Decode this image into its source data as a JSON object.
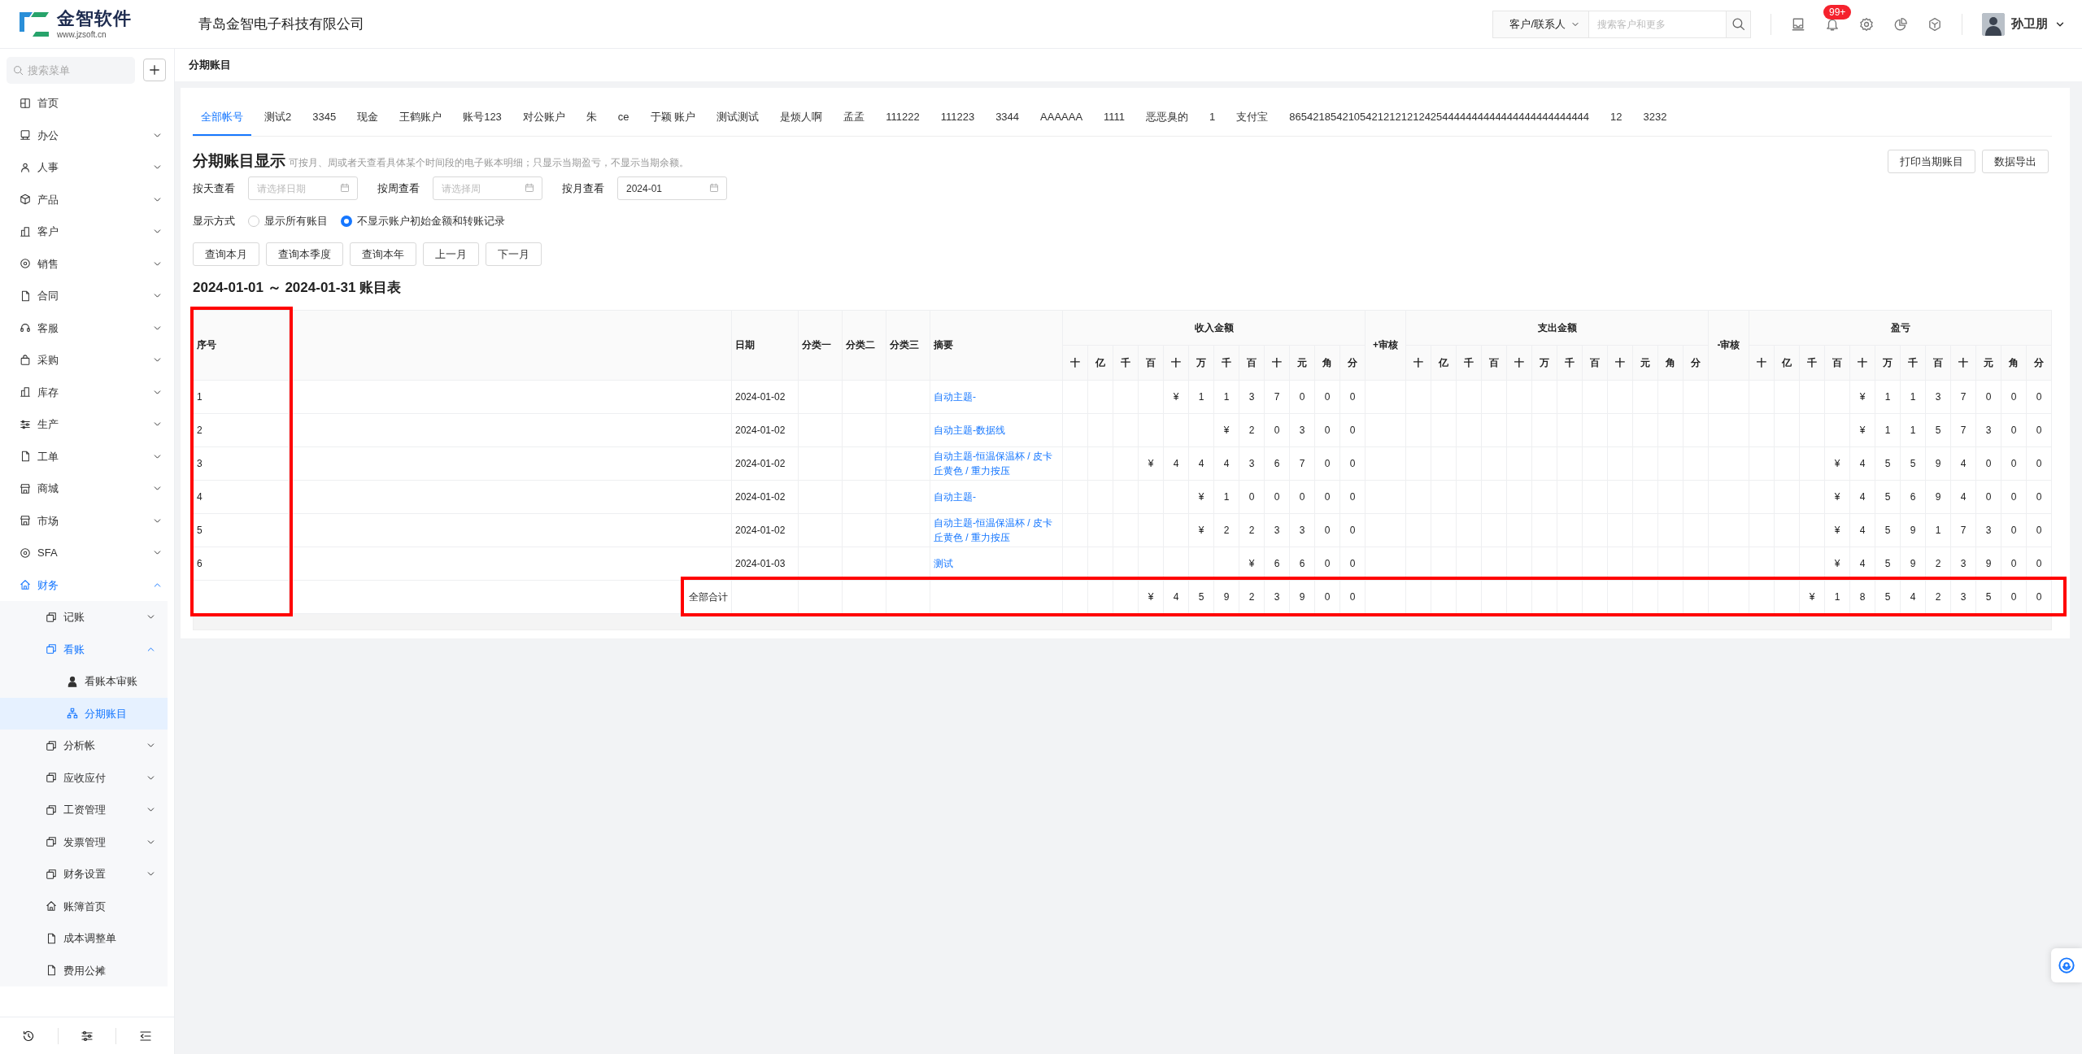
{
  "brand": {
    "name": "金智软件",
    "url": "www.jzsoft.cn"
  },
  "company": "青岛金智电子科技有限公司",
  "header": {
    "search_scope": "客户/联系人",
    "search_placeholder": "搜索客户和更多",
    "notification_badge": "99+",
    "user": "孙卫朋"
  },
  "sidebar": {
    "search_placeholder": "搜索菜单",
    "items": [
      {
        "label": "首页",
        "expandable": false,
        "selected": false
      },
      {
        "label": "办公",
        "expandable": true,
        "expanded": false,
        "selected": false
      },
      {
        "label": "人事",
        "expandable": true,
        "expanded": false,
        "selected": false
      },
      {
        "label": "产品",
        "expandable": true,
        "expanded": false,
        "selected": false
      },
      {
        "label": "客户",
        "expandable": true,
        "expanded": false,
        "selected": false
      },
      {
        "label": "销售",
        "expandable": true,
        "expanded": false,
        "selected": false
      },
      {
        "label": "合同",
        "expandable": true,
        "expanded": false,
        "selected": false
      },
      {
        "label": "客服",
        "expandable": true,
        "expanded": false,
        "selected": false
      },
      {
        "label": "采购",
        "expandable": true,
        "expanded": false,
        "selected": false
      },
      {
        "label": "库存",
        "expandable": true,
        "expanded": false,
        "selected": false
      },
      {
        "label": "生产",
        "expandable": true,
        "expanded": false,
        "selected": false
      },
      {
        "label": "工单",
        "expandable": true,
        "expanded": false,
        "selected": false
      },
      {
        "label": "商城",
        "expandable": true,
        "expanded": false,
        "selected": false
      },
      {
        "label": "市场",
        "expandable": true,
        "expanded": false,
        "selected": false
      },
      {
        "label": "SFA",
        "expandable": true,
        "expanded": false,
        "selected": false
      },
      {
        "label": "财务",
        "expandable": true,
        "expanded": true,
        "selected": false,
        "children": [
          {
            "label": "记账",
            "expandable": true,
            "expanded": false,
            "selected": false
          },
          {
            "label": "看账",
            "expandable": true,
            "expanded": true,
            "selected": false,
            "children": [
              {
                "label": "看账本审账",
                "expandable": false,
                "selected": false
              },
              {
                "label": "分期账目",
                "expandable": false,
                "selected": true
              }
            ]
          },
          {
            "label": "分析帐",
            "expandable": true,
            "expanded": false,
            "selected": false
          },
          {
            "label": "应收应付",
            "expandable": true,
            "expanded": false,
            "selected": false
          },
          {
            "label": "工资管理",
            "expandable": true,
            "expanded": false,
            "selected": false
          },
          {
            "label": "发票管理",
            "expandable": true,
            "expanded": false,
            "selected": false
          },
          {
            "label": "财务设置",
            "expandable": true,
            "expanded": false,
            "selected": false
          },
          {
            "label": "账簿首页",
            "expandable": false,
            "selected": false
          },
          {
            "label": "成本调整单",
            "expandable": false,
            "selected": false
          },
          {
            "label": "费用公摊",
            "expandable": false,
            "selected": false
          }
        ]
      }
    ]
  },
  "page_title": "分期账目",
  "tabs": [
    {
      "label": "全部帐号",
      "selected": true
    },
    {
      "label": "测试2",
      "selected": false
    },
    {
      "label": "3345",
      "selected": false
    },
    {
      "label": "现金",
      "selected": false
    },
    {
      "label": "王鹤账户",
      "selected": false
    },
    {
      "label": "账号123",
      "selected": false
    },
    {
      "label": "对公账户",
      "selected": false
    },
    {
      "label": "朱",
      "selected": false
    },
    {
      "label": "ce",
      "selected": false
    },
    {
      "label": "于颖 账户",
      "selected": false
    },
    {
      "label": "测试测试",
      "selected": false
    },
    {
      "label": "是烦人啊",
      "selected": false
    },
    {
      "label": "孟孟",
      "selected": false
    },
    {
      "label": "111222",
      "selected": false
    },
    {
      "label": "111223",
      "selected": false
    },
    {
      "label": "3344",
      "selected": false
    },
    {
      "label": "AAAAAA",
      "selected": false
    },
    {
      "label": "1111",
      "selected": false
    },
    {
      "label": "恶恶臭的",
      "selected": false
    },
    {
      "label": "1",
      "selected": false
    },
    {
      "label": "支付宝",
      "selected": false
    },
    {
      "label": "865421854210542121212124254444444444444444444444444",
      "selected": false
    },
    {
      "label": "12",
      "selected": false
    },
    {
      "label": "3232",
      "selected": false
    }
  ],
  "report": {
    "title": "分期账目显示",
    "hint": "可按月、周或者天查看具体某个时间段的电子账本明细；只显示当期盈亏，不显示当期余额。",
    "actions": [
      "打印当期账目",
      "数据导出"
    ]
  },
  "filters": [
    {
      "label": "按天查看",
      "placeholder": "请选择日期"
    },
    {
      "label": "按周查看",
      "placeholder": "请选择周"
    },
    {
      "label": "按月查看",
      "value": "2024-01"
    }
  ],
  "display_mode": {
    "label": "显示方式",
    "options": [
      {
        "label": "显示所有账目",
        "selected": false
      },
      {
        "label": "不显示账户初始金额和转账记录",
        "selected": true
      }
    ]
  },
  "quick_buttons": [
    "查询本月",
    "查询本季度",
    "查询本年",
    "上一月",
    "下一月"
  ],
  "table_title": "2024-01-01 ～ 2024-01-31 账目表",
  "table": {
    "headers": {
      "seq": "序号",
      "date": "日期",
      "category_1": "分类一",
      "category_2": "分类二",
      "category_3": "分类三",
      "summary": "摘要",
      "income_audit": "+审核",
      "expense_audit": "-审核"
    },
    "money_groups": [
      {
        "label": "收入金额",
        "units": [
          "十",
          "亿",
          "千",
          "百",
          "十",
          "万",
          "千",
          "百",
          "十",
          "元",
          "角",
          "分"
        ]
      },
      {
        "label": "支出金额",
        "units": [
          "十",
          "亿",
          "千",
          "百",
          "十",
          "万",
          "千",
          "百",
          "十",
          "元",
          "角",
          "分"
        ]
      },
      {
        "label": "盈亏",
        "units": [
          "十",
          "亿",
          "千",
          "百",
          "十",
          "万",
          "千",
          "百",
          "十",
          "元",
          "角",
          "分"
        ]
      }
    ],
    "seq_highlighted": true,
    "rows": [
      {
        "seq": "1",
        "date": "2024-01-02",
        "summary": "自动主题-",
        "income": [
          "¥",
          "1",
          "1",
          "3",
          "7",
          "0",
          "0",
          "0"
        ],
        "profit": [
          "¥",
          "1",
          "1",
          "3",
          "7",
          "0",
          "0",
          "0"
        ]
      },
      {
        "seq": "2",
        "date": "2024-01-02",
        "summary": "自动主题-数据线",
        "income": [
          "¥",
          "2",
          "0",
          "3",
          "0",
          "0"
        ],
        "profit": [
          "¥",
          "1",
          "1",
          "5",
          "7",
          "3",
          "0",
          "0"
        ]
      },
      {
        "seq": "3",
        "date": "2024-01-02",
        "summary": "自动主题-恒温保温杯 / 皮卡丘黄色 / 重力按压",
        "income": [
          "¥",
          "4",
          "4",
          "4",
          "3",
          "6",
          "7",
          "0",
          "0"
        ],
        "profit": [
          "¥",
          "4",
          "5",
          "5",
          "9",
          "4",
          "0",
          "0",
          "0"
        ]
      },
      {
        "seq": "4",
        "date": "2024-01-02",
        "summary": "自动主题-",
        "income": [
          "¥",
          "1",
          "0",
          "0",
          "0",
          "0",
          "0"
        ],
        "profit": [
          "¥",
          "4",
          "5",
          "6",
          "9",
          "4",
          "0",
          "0",
          "0"
        ]
      },
      {
        "seq": "5",
        "date": "2024-01-02",
        "summary": "自动主题-恒温保温杯 / 皮卡丘黄色 / 重力按压",
        "income": [
          "¥",
          "2",
          "2",
          "3",
          "3",
          "0",
          "0"
        ],
        "profit": [
          "¥",
          "4",
          "5",
          "9",
          "1",
          "7",
          "3",
          "0",
          "0"
        ]
      },
      {
        "seq": "6",
        "date": "2024-01-03",
        "summary": "测试",
        "income": [
          "¥",
          "6",
          "6",
          "0",
          "0"
        ],
        "profit": [
          "¥",
          "4",
          "5",
          "9",
          "2",
          "3",
          "9",
          "0",
          "0"
        ]
      }
    ],
    "total": {
      "label": "全部合计",
      "highlighted": true,
      "income": [
        "¥",
        "4",
        "5",
        "9",
        "2",
        "3",
        "9",
        "0",
        "0"
      ],
      "profit": [
        "¥",
        "1",
        "8",
        "5",
        "4",
        "2",
        "3",
        "5",
        "0",
        "0"
      ]
    }
  }
}
